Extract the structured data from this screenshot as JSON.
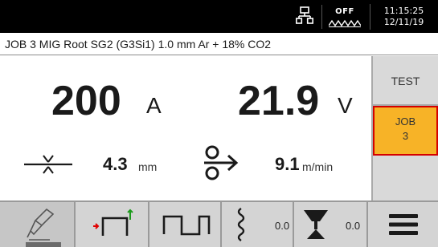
{
  "status_bar": {
    "arc_label": "OFF",
    "time": "11:15:25",
    "date": "12/11/19"
  },
  "job_info": "JOB 3  MIG  Root  SG2 (G3Si1)  1.0 mm  Ar + 18% CO2",
  "main": {
    "current": {
      "value": "200",
      "unit": "A"
    },
    "voltage": {
      "value": "21.9",
      "unit": "V"
    },
    "thickness": {
      "value": "4.3",
      "unit": "mm"
    },
    "wire_feed": {
      "value": "9.1",
      "unit": "m/min"
    }
  },
  "right_panel": {
    "test_label": "TEST",
    "job_label": "JOB",
    "job_number": "3"
  },
  "toolbar": {
    "ramp_value": "0.0",
    "crater_value": "0.0"
  },
  "colors": {
    "status_bar_bg": "#000000",
    "job_button_bg": "#f7b327",
    "job_button_border": "#d40000",
    "panel_bg": "#d9d9d9",
    "toolbar_bg": "#d4d4d4",
    "accent_red": "#e00000",
    "accent_green": "#1a9a1a"
  },
  "icons": [
    "network-icon",
    "arc-off-icon",
    "material-thickness-icon",
    "wire-feed-icon",
    "torch-icon",
    "two-stroke-mode-icon",
    "pulse-wave-icon",
    "ramp-icon",
    "crater-fill-icon",
    "menu-icon"
  ]
}
